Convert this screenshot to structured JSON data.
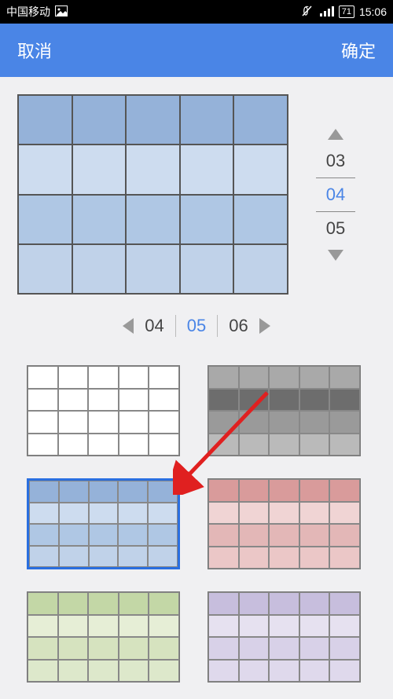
{
  "status": {
    "carrier": "中国移动",
    "battery": "71",
    "time": "15:06"
  },
  "actionbar": {
    "cancel": "取消",
    "confirm": "确定"
  },
  "row_spinner": {
    "above": "03",
    "selected": "04",
    "below": "05"
  },
  "col_spinner": {
    "left": "04",
    "selected": "05",
    "right": "06"
  },
  "preview_colors": {
    "r0": "#95b2d9",
    "r1": "#cddcef",
    "r2": "#afc7e4",
    "r3": "#c0d2e9"
  },
  "thumbs": [
    {
      "name": "white",
      "selected": false,
      "c": [
        "#ffffff",
        "#ffffff",
        "#ffffff",
        "#ffffff"
      ]
    },
    {
      "name": "gray",
      "selected": false,
      "c": [
        "#a9a9a9",
        "#6d6d6d",
        "#9a9a9a",
        "#bababa"
      ]
    },
    {
      "name": "blue",
      "selected": true,
      "c": [
        "#95b2d9",
        "#cddcef",
        "#afc7e4",
        "#c0d2e9"
      ]
    },
    {
      "name": "red",
      "selected": false,
      "c": [
        "#d99b9b",
        "#f0d4d4",
        "#e3b7b7",
        "#ebc7c7"
      ]
    },
    {
      "name": "green",
      "selected": false,
      "c": [
        "#c3d7a6",
        "#e6eed6",
        "#d6e3bf",
        "#dde8cb"
      ]
    },
    {
      "name": "purple",
      "selected": false,
      "c": [
        "#c7bedd",
        "#e6e1f0",
        "#d8d1e8",
        "#dfd9ec"
      ]
    }
  ],
  "icons": {
    "image": "image-icon",
    "mute": "mute-icon",
    "signal": "signal-icon"
  }
}
